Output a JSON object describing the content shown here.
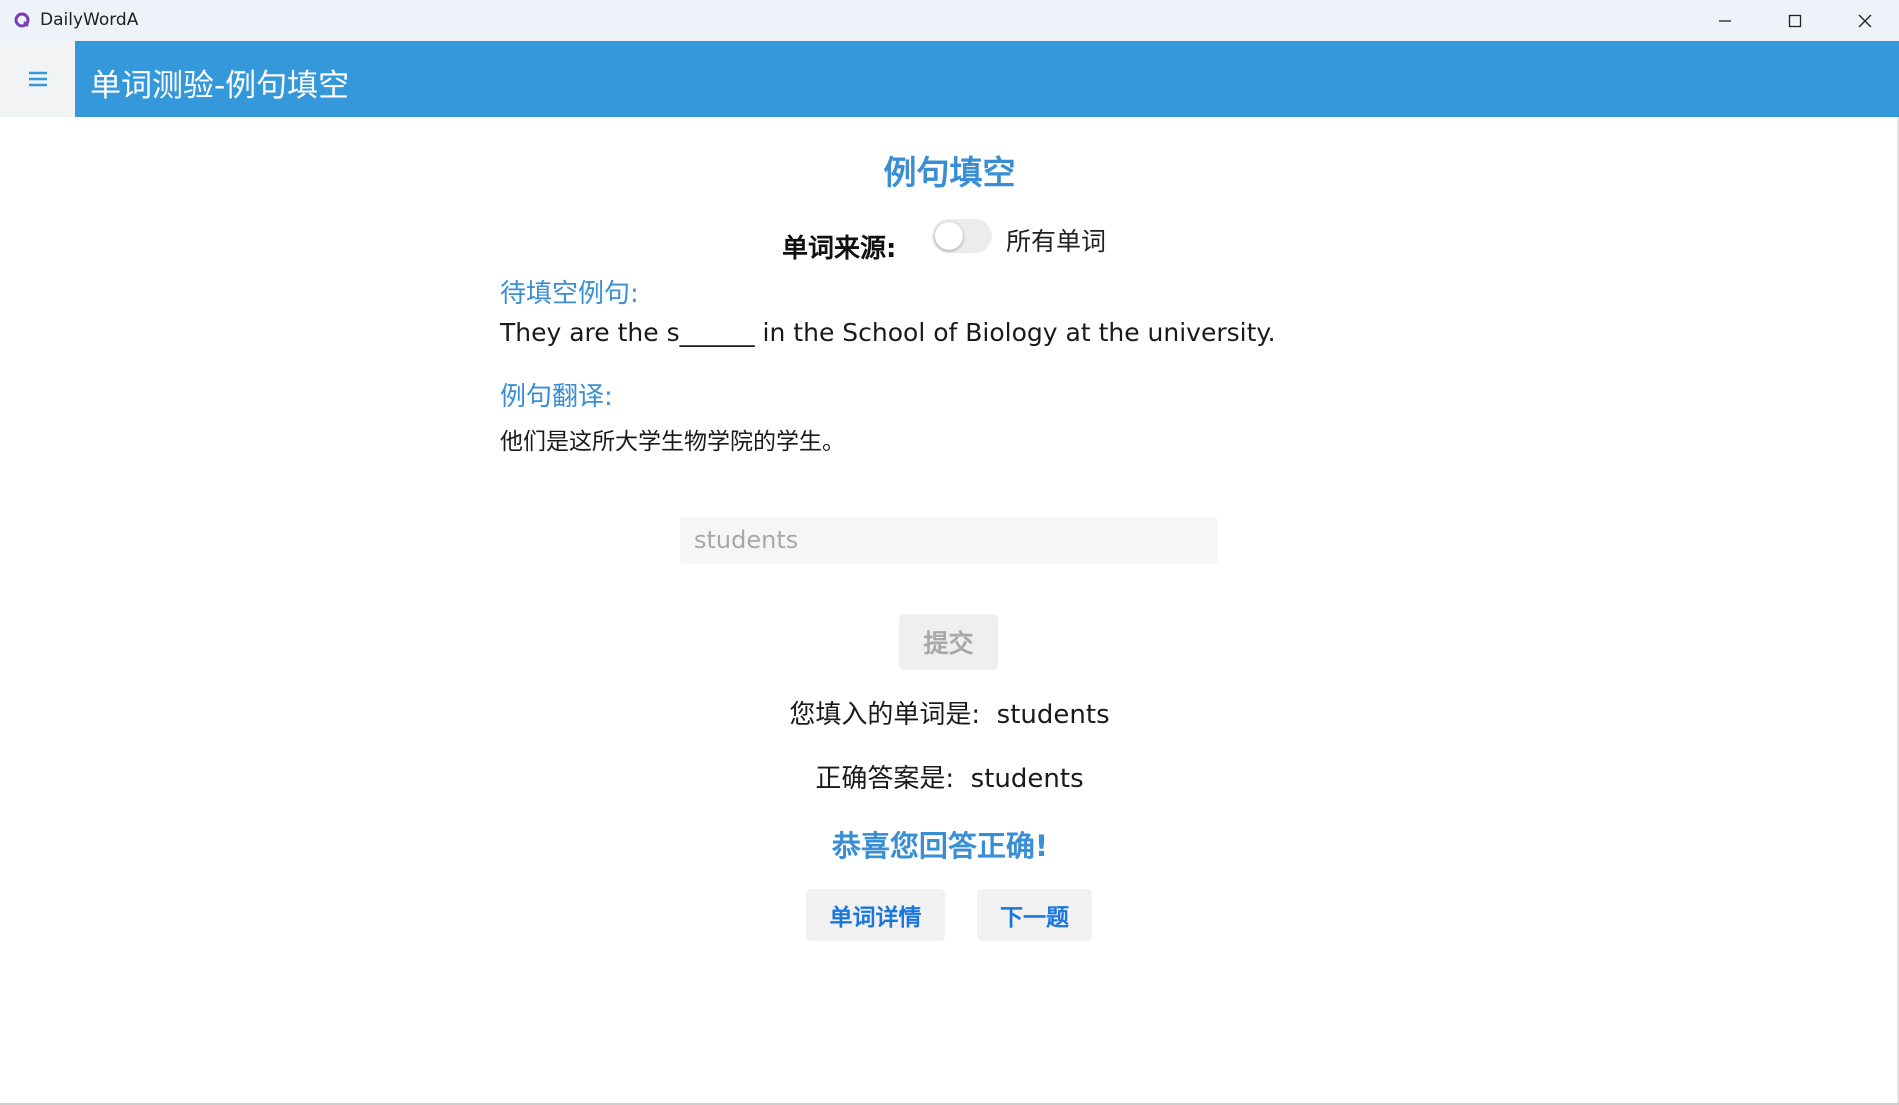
{
  "window": {
    "app_title": "DailyWordA"
  },
  "header": {
    "menu_icon": "hamburger-menu-icon",
    "title": "单词测验-例句填空"
  },
  "main": {
    "section_title": "例句填空",
    "source": {
      "label": "单词来源:",
      "toggle_on": false,
      "value": "所有单词"
    },
    "sentence_label": "待填空例句:",
    "sentence": "They are the s______ in the School of Biology at the university.",
    "translation_label": "例句翻译:",
    "translation": "他们是这所大学生物学院的学生。",
    "input_value": "students",
    "submit_label": "提交",
    "your_answer_label": "您填入的单词是:",
    "your_answer": "students",
    "correct_answer_label": "正确答案是:",
    "correct_answer": "students",
    "congrats": "恭喜您回答正确!",
    "details_button": "单词详情",
    "next_button": "下一题"
  },
  "colors": {
    "header_bg": "#3598db",
    "accent_blue": "#3a8fd4",
    "button_text_blue": "#1976e0"
  }
}
